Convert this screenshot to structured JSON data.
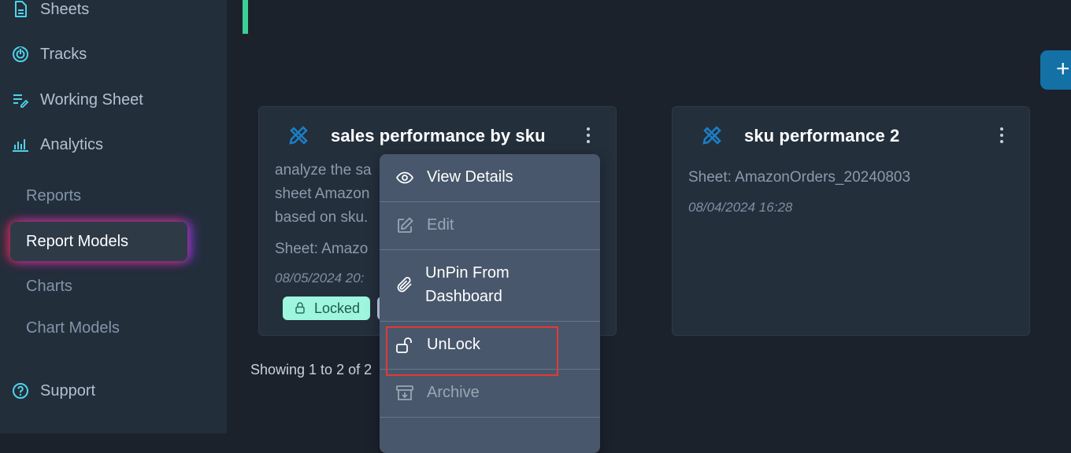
{
  "sidebar": {
    "items": [
      {
        "label": "Sheets",
        "icon": "document-icon"
      },
      {
        "label": "Tracks",
        "icon": "tracks-icon"
      },
      {
        "label": "Working Sheet",
        "icon": "working-sheet-icon"
      },
      {
        "label": "Analytics",
        "icon": "bar-chart-icon"
      }
    ],
    "analytics_sub": [
      {
        "label": "Reports"
      },
      {
        "label": "Report Models",
        "active": true
      },
      {
        "label": "Charts"
      },
      {
        "label": "Chart Models"
      }
    ],
    "support": {
      "label": "Support",
      "icon": "help-circle-icon"
    }
  },
  "header": {
    "add_button_label": "+"
  },
  "cards": [
    {
      "title": "sales performance by sku",
      "description_lines": [
        "analyze the sa",
        "sheet Amazon",
        "based on sku."
      ],
      "sheet": "Sheet: Amazo",
      "date": "08/05/2024 20:",
      "badge": "Locked"
    },
    {
      "title": "sku performance 2",
      "sheet": "Sheet: AmazonOrders_20240803",
      "date": "08/04/2024 16:28"
    }
  ],
  "pagination": {
    "text": "Showing 1 to 2 of 2"
  },
  "context_menu": {
    "items": [
      {
        "label": "View Details",
        "icon": "eye-icon",
        "enabled": true
      },
      {
        "label": "Edit",
        "icon": "edit-icon",
        "enabled": false
      },
      {
        "label_line1": "UnPin From",
        "label_line2": "Dashboard",
        "icon": "paperclip-icon",
        "enabled": true
      },
      {
        "label": "UnLock",
        "icon": "unlock-icon",
        "enabled": true,
        "highlighted": true
      },
      {
        "label": "Archive",
        "icon": "archive-icon",
        "enabled": false
      }
    ]
  },
  "colors": {
    "accent_cyan": "#4dd3e8",
    "brand_blue": "#1471a5",
    "green_bar": "#3ecf96",
    "highlight_red": "#e53935"
  }
}
